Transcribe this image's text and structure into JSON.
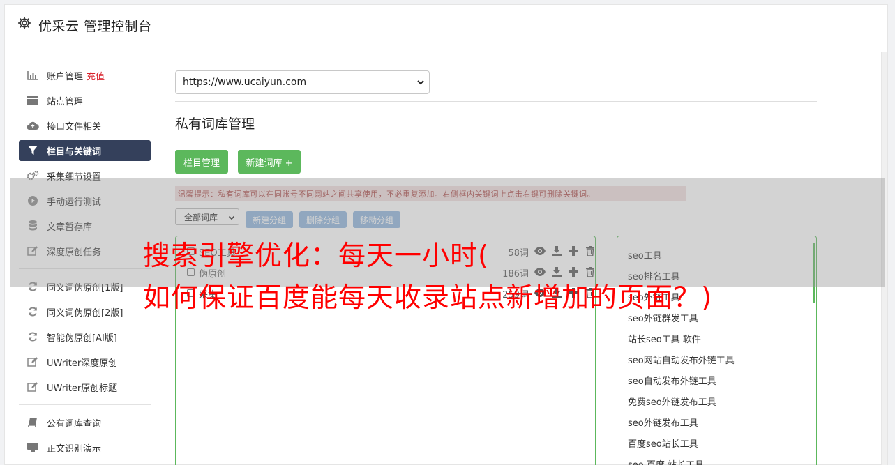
{
  "header": {
    "title": "优采云 管理控制台",
    "icon": "gear-icon"
  },
  "sidebar": {
    "items": [
      {
        "label": "账户管理",
        "badge": "充值",
        "icon": "bar-chart-icon"
      },
      {
        "label": "站点管理",
        "icon": "server-icon"
      },
      {
        "label": "接口文件相关",
        "icon": "cloud-upload-icon"
      },
      {
        "label": "栏目与关键词",
        "icon": "filter-icon",
        "active": true
      },
      {
        "label": "采集细节设置",
        "icon": "gears-icon"
      },
      {
        "label": "手动运行测试",
        "icon": "play-circle-icon"
      },
      {
        "label": "文章暂存库",
        "icon": "database-icon"
      },
      {
        "label": "深度原创任务",
        "icon": "edit-icon"
      }
    ],
    "items2": [
      {
        "label": "同义词伪原创[1版]",
        "icon": "refresh-icon"
      },
      {
        "label": "同义词伪原创[2版]",
        "icon": "refresh-icon"
      },
      {
        "label": "智能伪原创[AI版]",
        "icon": "refresh-icon"
      },
      {
        "label": "UWriter深度原创",
        "icon": "edit-icon"
      },
      {
        "label": "UWriter原创标题",
        "icon": "edit-icon"
      }
    ],
    "items3": [
      {
        "label": "公有词库查询",
        "icon": "book-icon"
      },
      {
        "label": "正文识别演示",
        "icon": "monitor-icon"
      }
    ]
  },
  "main": {
    "site_select": "https://www.ucaiyun.com",
    "section_title": "私有词库管理",
    "btn_columns": "栏目管理",
    "btn_new_lib": "新建词库 +",
    "tip": "温馨提示：私有词库可以在同账号不同网站之间共享使用，不必重复添加。右侧框内关键词上点击右键可删除关键词。",
    "filter_select": "全部词库",
    "btn_new_group": "新建分组",
    "btn_delete_group": "删除分组",
    "btn_move_group": "移动分组",
    "libraries": [
      {
        "name": "SEO工具",
        "count": "58词"
      },
      {
        "name": "伪原创",
        "count": "186词"
      },
      {
        "name": "采集",
        "count": "259词"
      }
    ],
    "keywords": [
      "seo工具",
      "seo排名工具",
      "seo外链工具",
      "seo外链群发工具",
      "站长seo工具 软件",
      "seo网站自动发布外链工具",
      "seo自动发布外链工具",
      "免费seo外链发布工具",
      "seo外链发布工具",
      "百度seo站长工具",
      "seo 百度 站长工具"
    ]
  },
  "overlay": {
    "line1": "搜索引擎优化：每天一小时(",
    "line2": "如何保证百度能每天收录站点新增加的页面？)"
  }
}
